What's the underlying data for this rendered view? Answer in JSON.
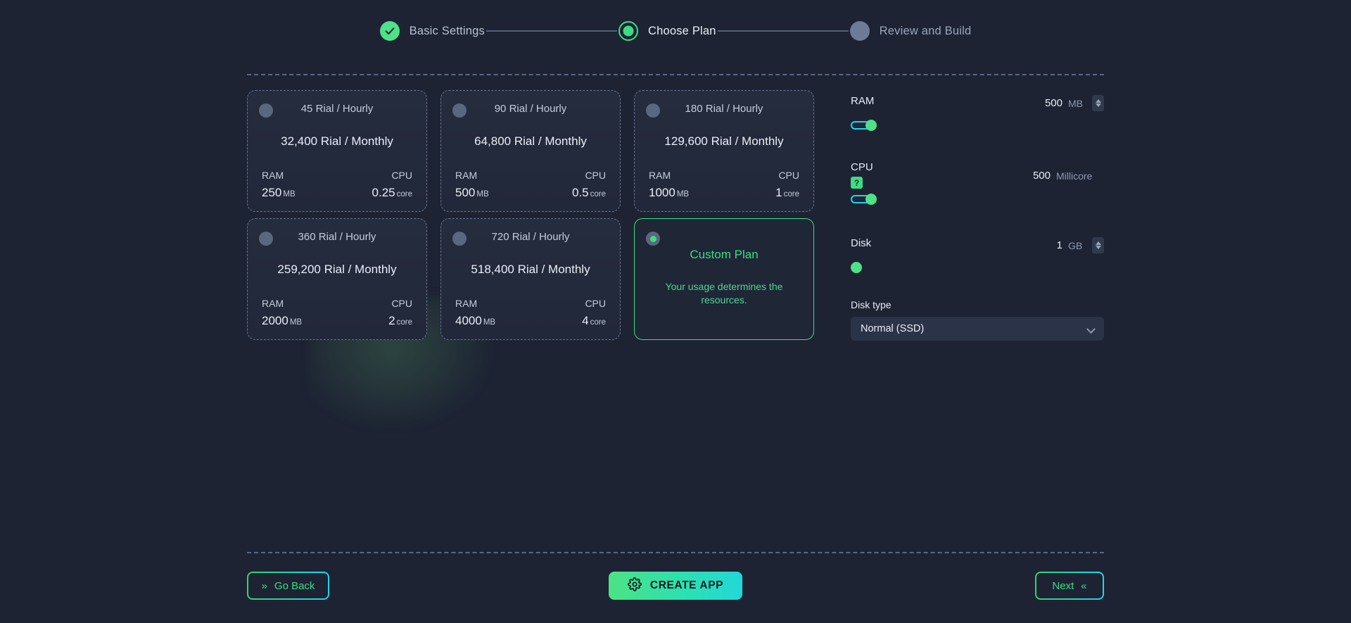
{
  "theme": {
    "background": "#1d2333",
    "accent_green": "#3ddc84",
    "accent_cyan": "#22d3ee",
    "card_bg": "#252c3e",
    "muted_text": "#8e9ab1"
  },
  "stepper": {
    "steps": [
      {
        "label": "Basic Settings",
        "state": "done",
        "icon": "check-icon"
      },
      {
        "label": "Choose Plan",
        "state": "active",
        "icon": "filled-circle-icon"
      },
      {
        "label": "Review and Build",
        "state": "todo",
        "icon": "empty-circle-icon"
      }
    ]
  },
  "plans": [
    {
      "hourly": "45 Rial / Hourly",
      "monthly": "32,400 Rial / Monthly",
      "ram_label": "RAM",
      "ram_value": "250",
      "ram_unit": "MB",
      "cpu_label": "CPU",
      "cpu_value": "0.25",
      "cpu_unit": "core",
      "selected": false
    },
    {
      "hourly": "90 Rial / Hourly",
      "monthly": "64,800 Rial / Monthly",
      "ram_label": "RAM",
      "ram_value": "500",
      "ram_unit": "MB",
      "cpu_label": "CPU",
      "cpu_value": "0.5",
      "cpu_unit": "core",
      "selected": false
    },
    {
      "hourly": "180 Rial / Hourly",
      "monthly": "129,600 Rial / Monthly",
      "ram_label": "RAM",
      "ram_value": "1000",
      "ram_unit": "MB",
      "cpu_label": "CPU",
      "cpu_value": "1",
      "cpu_unit": "core",
      "selected": false
    },
    {
      "hourly": "360 Rial / Hourly",
      "monthly": "259,200 Rial / Monthly",
      "ram_label": "RAM",
      "ram_value": "2000",
      "ram_unit": "MB",
      "cpu_label": "CPU",
      "cpu_value": "2",
      "cpu_unit": "core",
      "selected": false
    },
    {
      "hourly": "720 Rial / Hourly",
      "monthly": "518,400 Rial / Monthly",
      "ram_label": "RAM",
      "ram_value": "4000",
      "ram_unit": "MB",
      "cpu_label": "CPU",
      "cpu_value": "4",
      "cpu_unit": "core",
      "selected": false
    }
  ],
  "custom_plan": {
    "title": "Custom Plan",
    "description": "Your usage determines the resources.",
    "selected": true
  },
  "config": {
    "ram": {
      "label": "RAM",
      "value": "500",
      "unit": "MB",
      "slider_percent": 4,
      "has_stepper": true,
      "has_help": false
    },
    "cpu": {
      "label": "CPU",
      "value": "500",
      "unit": "Millicore",
      "slider_percent": 4,
      "has_stepper": false,
      "has_help": true,
      "help_glyph": "?"
    },
    "disk": {
      "label": "Disk",
      "value": "1",
      "unit": "GB",
      "slider_percent": 0,
      "has_stepper": true,
      "has_help": false
    },
    "disk_type": {
      "label": "Disk type",
      "selected": "Normal (SSD)"
    }
  },
  "footer": {
    "go_back": {
      "label": "Go Back",
      "chevron": "»"
    },
    "create": {
      "label": "CREATE APP",
      "icon": "gear-icon"
    },
    "next": {
      "label": "Next",
      "chevron": "«"
    }
  }
}
